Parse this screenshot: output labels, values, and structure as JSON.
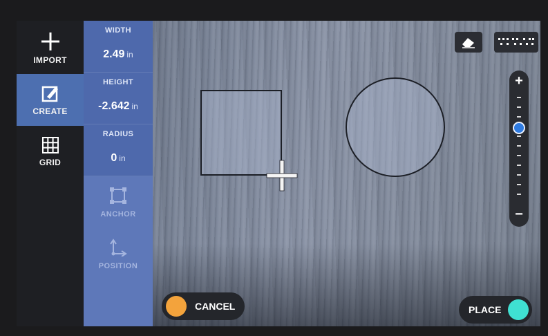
{
  "nav": {
    "import_label": "IMPORT",
    "create_label": "CREATE",
    "grid_label": "GRID"
  },
  "properties": {
    "width": {
      "label": "WIDTH",
      "value": "2.49",
      "unit": "in"
    },
    "height": {
      "label": "HEIGHT",
      "value": "-2.642",
      "unit": "in"
    },
    "radius": {
      "label": "RADIUS",
      "value": "0",
      "unit": "in"
    }
  },
  "tools": {
    "anchor_label": "ANCHOR",
    "position_label": "POSITION"
  },
  "actions": {
    "cancel_label": "CANCEL",
    "place_label": "PLACE"
  },
  "zoom": {
    "level_fraction": 0.33
  },
  "colors": {
    "nav_bg": "#1e1f23",
    "active_blue": "#4d6fb0",
    "panel_blue": "#5e78b9",
    "cancel_orange": "#f3a33c",
    "place_teal": "#3fe0d2",
    "zoom_knob": "#2f7be0"
  },
  "icons": {
    "import": "plus-icon",
    "create": "pen-square-icon",
    "grid": "grid-icon",
    "anchor": "anchor-box-icon",
    "position": "position-axes-icon",
    "eraser": "eraser-icon",
    "dots": "dotted-pattern-icon"
  }
}
